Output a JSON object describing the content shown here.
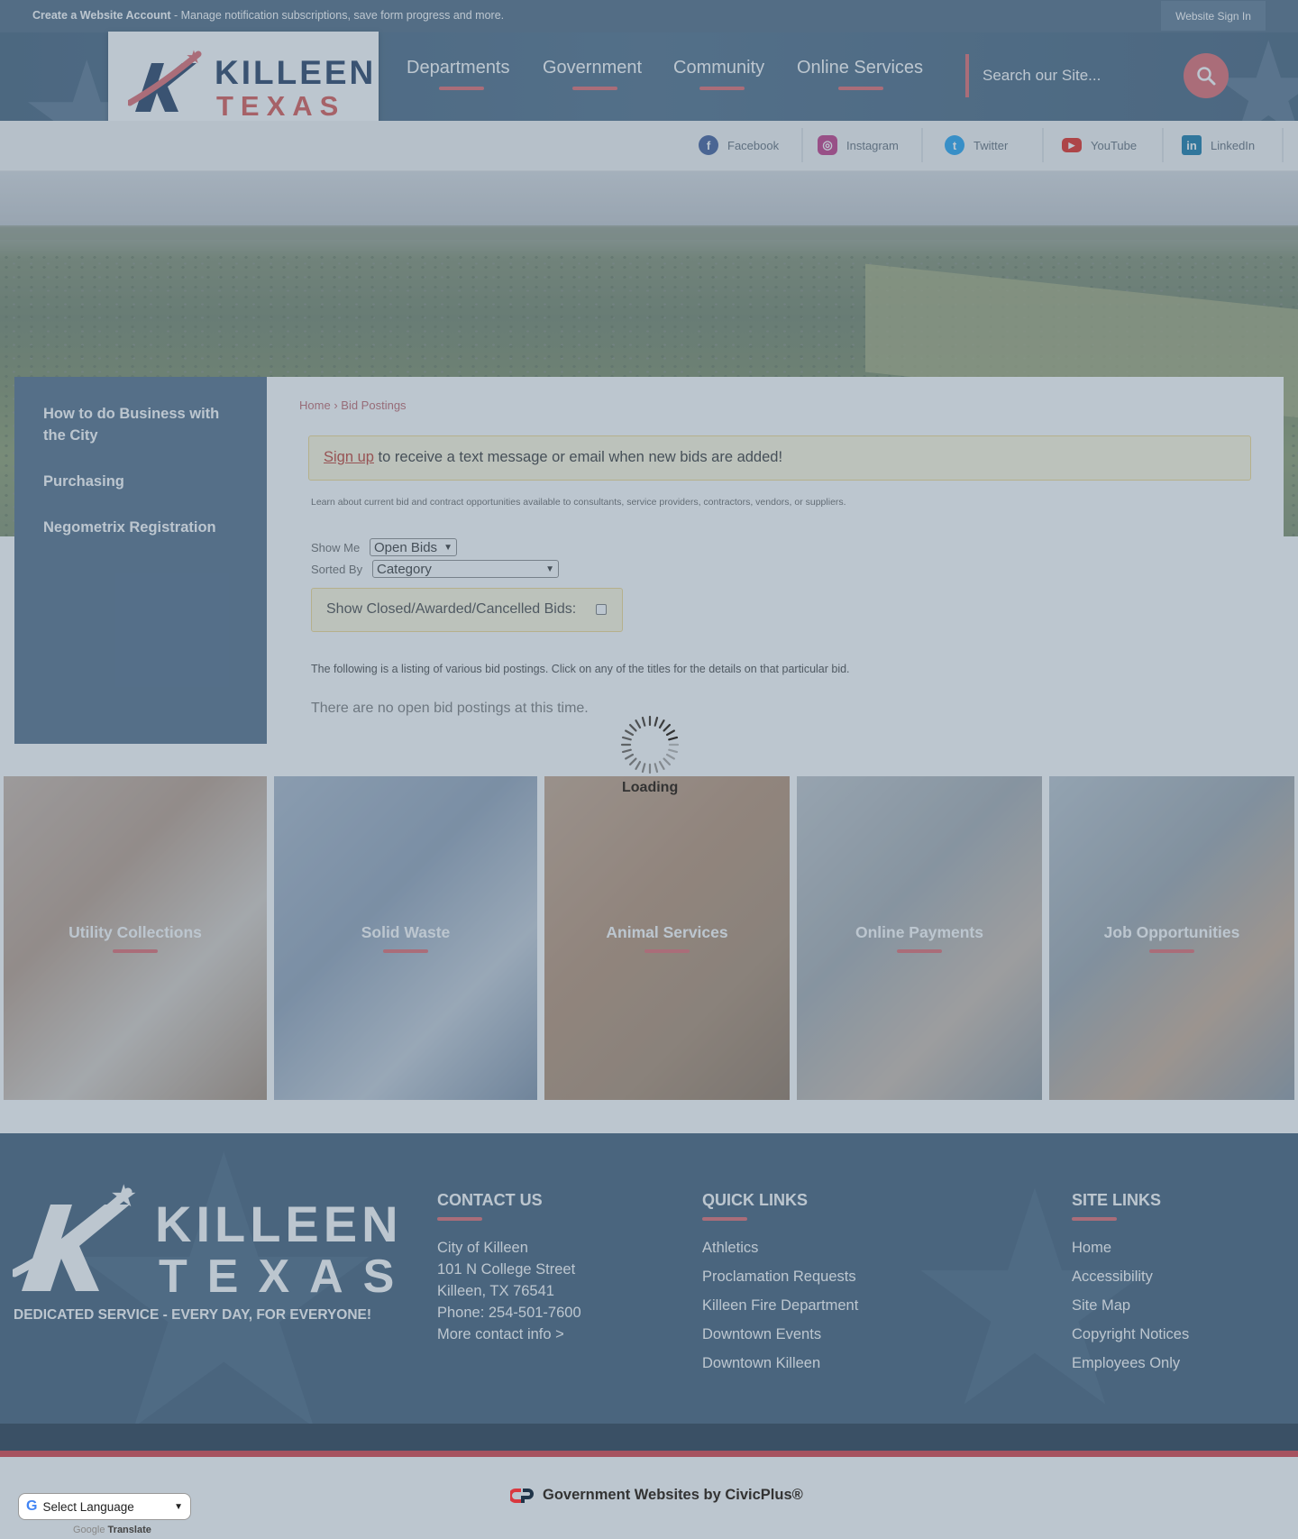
{
  "topbar": {
    "create_account": "Create a Website Account",
    "message": " - Manage notification subscriptions, save form progress and more.",
    "sign_in": "Website Sign In"
  },
  "logo": {
    "line1": "KILLEEN",
    "line2": "TEXAS"
  },
  "nav": [
    "Departments",
    "Government",
    "Community",
    "Online Services"
  ],
  "search": {
    "placeholder": "Search our Site..."
  },
  "social": [
    {
      "label": "Facebook",
      "icon": "facebook-icon",
      "color": "#3b5998"
    },
    {
      "label": "Instagram",
      "icon": "instagram-icon",
      "color": "#c13584"
    },
    {
      "label": "Twitter",
      "icon": "twitter-icon",
      "color": "#1da1f2"
    },
    {
      "label": "YouTube",
      "icon": "youtube-icon",
      "color": "#e62117"
    },
    {
      "label": "LinkedIn",
      "icon": "linkedin-icon",
      "color": "#0e76a8"
    }
  ],
  "sidebar": {
    "items": [
      {
        "label": "How to do Business with the City"
      },
      {
        "label": "Purchasing"
      },
      {
        "label": "Negometrix Registration"
      }
    ]
  },
  "breadcrumb": {
    "home": "Home",
    "sep": "›",
    "current": "Bid Postings"
  },
  "alert": {
    "link": "Sign up",
    "text": " to receive a text message or email when new bids are added!"
  },
  "intro": "Learn about current bid and contract opportunities available to consultants, service providers, contractors, vendors, or suppliers.",
  "filters": {
    "show_me_label": "Show Me",
    "show_me_value": "Open Bids",
    "sorted_by_label": "Sorted By",
    "sorted_by_value": "Category",
    "closed_label": "Show Closed/Awarded/Cancelled Bids:"
  },
  "listing_text": "The following is a listing of various bid postings. Click on any of the titles for the details on that particular bid.",
  "no_bids": "There are no open bid postings at this time.",
  "loading": "Loading",
  "tiles": [
    {
      "label": "Utility Collections"
    },
    {
      "label": "Solid Waste"
    },
    {
      "label": "Animal Services"
    },
    {
      "label": "Online Payments"
    },
    {
      "label": "Job Opportunities"
    }
  ],
  "footer": {
    "logo_line1": "KILLEEN",
    "logo_line2": "TEXAS",
    "tagline": "DEDICATED SERVICE - EVERY DAY, FOR EVERYONE!",
    "contact": {
      "heading": "CONTACT US",
      "lines": [
        "City of Killeen",
        "101 N College Street",
        "Killeen, TX 76541",
        "Phone: 254-501-7600",
        "More contact info >"
      ]
    },
    "quick_links": {
      "heading": "QUICK LINKS",
      "items": [
        "Athletics",
        "Proclamation Requests",
        "Killeen Fire Department",
        "Downtown Events",
        "Downtown Killeen"
      ]
    },
    "site_links": {
      "heading": "SITE LINKS",
      "items": [
        "Home",
        "Accessibility",
        "Site Map",
        "Copyright Notices",
        "Employees Only"
      ]
    }
  },
  "civicplus": "Government Websites by CivicPlus®",
  "translate": {
    "select": "Select Language",
    "powered": "Google",
    "translate": "Translate"
  },
  "colors": {
    "accent": "#e0676c",
    "navy": "#1f3a5f",
    "header": "#4a6a86"
  }
}
